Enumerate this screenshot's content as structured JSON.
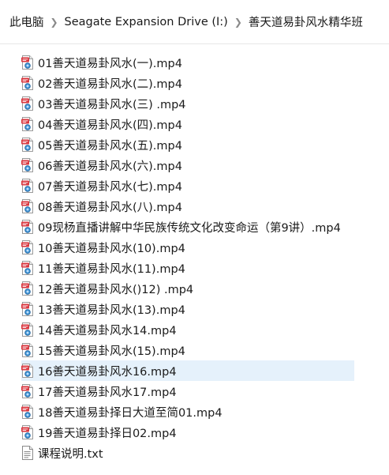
{
  "breadcrumb": {
    "items": [
      "此电脑",
      "Seagate Expansion Drive (I:)",
      "善天道易卦风水精华班"
    ]
  },
  "files": [
    {
      "name": "01善天道易卦风水(一).mp4",
      "type": "video"
    },
    {
      "name": "02善天道易卦风水(二).mp4",
      "type": "video"
    },
    {
      "name": "03善天道易卦风水(三)  .mp4",
      "type": "video"
    },
    {
      "name": "04善天道易卦风水(四).mp4",
      "type": "video"
    },
    {
      "name": "05善天道易卦风水(五).mp4",
      "type": "video"
    },
    {
      "name": "06善天道易卦风水(六).mp4",
      "type": "video"
    },
    {
      "name": "07善天道易卦风水(七).mp4",
      "type": "video"
    },
    {
      "name": "08善天道易卦风水(八).mp4",
      "type": "video"
    },
    {
      "name": "09现杨直播讲解中华民族传统文化改变命运（第9讲）.mp4",
      "type": "video"
    },
    {
      "name": "10善天道易卦风水(10).mp4",
      "type": "video"
    },
    {
      "name": "11善天道易卦风水(11).mp4",
      "type": "video"
    },
    {
      "name": "12善天道易卦风水()12)  .mp4",
      "type": "video"
    },
    {
      "name": "13善天道易卦风水(13).mp4",
      "type": "video"
    },
    {
      "name": "14善天道易卦风水14.mp4",
      "type": "video"
    },
    {
      "name": "15善天道易卦风水(15).mp4",
      "type": "video"
    },
    {
      "name": "16善天道易卦风水16.mp4",
      "type": "video",
      "hovered": true
    },
    {
      "name": "17善天道易卦风水17.mp4",
      "type": "video"
    },
    {
      "name": "18善天道易卦择日大道至简01.mp4",
      "type": "video"
    },
    {
      "name": "19善天道易卦择日02.mp4",
      "type": "video"
    },
    {
      "name": "课程说明.txt",
      "type": "text"
    }
  ],
  "colors": {
    "hover": "#e5f1fb",
    "video_badge": "#d9363e",
    "video_lens": "#3a8fd0"
  }
}
